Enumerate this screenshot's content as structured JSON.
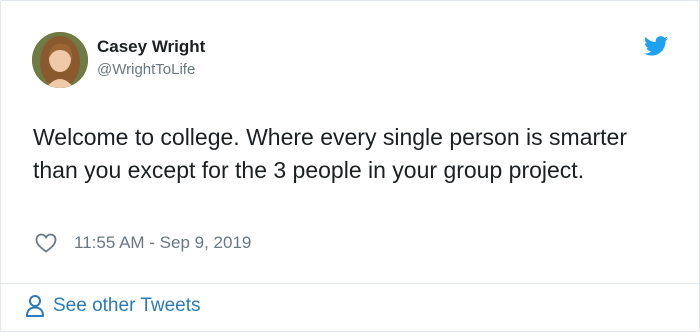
{
  "tweet": {
    "author_name": "Casey Wright",
    "author_handle": "@WrightToLife",
    "text": "Welcome to college. Where every single person is smarter than you except for the 3 people in your group project.",
    "timestamp": "11:55 AM - Sep 9, 2019",
    "avatar_icon": "profile-photo",
    "logo_icon": "twitter-bird-icon",
    "like_icon": "heart-icon"
  },
  "footer": {
    "see_other_label": "See other Tweets",
    "icon": "person-icon"
  },
  "colors": {
    "twitter_blue": "#1da1f2",
    "link_blue": "#2b7bb9",
    "text": "#1c2022",
    "muted": "#697882",
    "border": "#e1e8ed"
  }
}
